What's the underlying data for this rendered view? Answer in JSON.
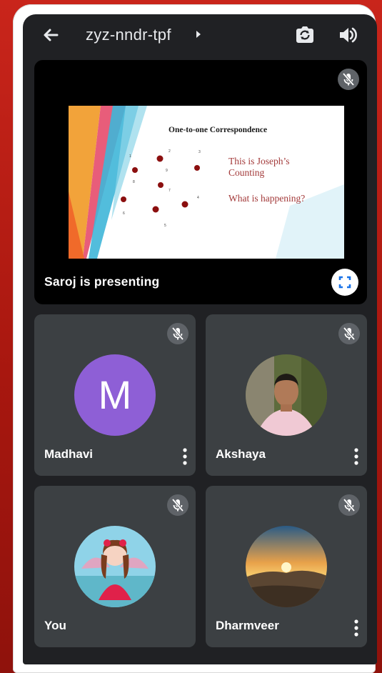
{
  "header": {
    "meeting_code": "zyz-nndr-tpf",
    "icons": [
      "back-arrow-icon",
      "caret-right-icon",
      "switch-camera-icon",
      "speaker-icon"
    ]
  },
  "presentation": {
    "presenter_label": "Saroj is presenting",
    "slide": {
      "title": "One-to-one Correspondence",
      "line1": "This is Joseph’s",
      "line2": "Counting",
      "line3": "What is happening?",
      "numbers": [
        "1",
        "2",
        "3",
        "4",
        "5",
        "6",
        "7",
        "8",
        "9"
      ]
    }
  },
  "participants": [
    {
      "name": "Madhavi",
      "initial": "M",
      "avatar_color": "#8e5fd6",
      "muted": true,
      "show_more": true
    },
    {
      "name": "Akshaya",
      "muted": true,
      "show_more": true
    },
    {
      "name": "You",
      "muted": true,
      "show_more": false
    },
    {
      "name": "Dharmveer",
      "muted": true,
      "show_more": true
    }
  ],
  "colors": {
    "screen_bg": "#202124",
    "tile_bg": "#3c4043",
    "mic_badge": "#5f6368",
    "accent_blue": "#1a73e8",
    "slide_text_red": "#a33a3a"
  }
}
